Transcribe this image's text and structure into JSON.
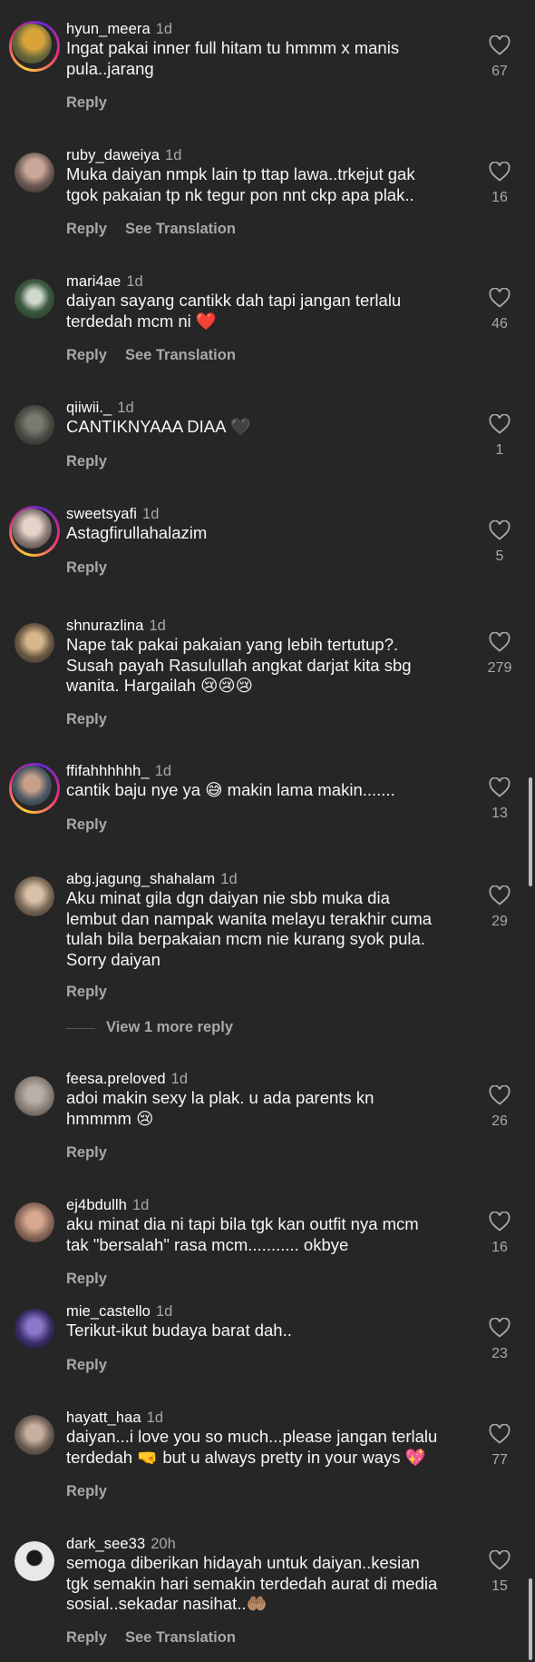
{
  "colors": {
    "background": "#262626",
    "text_primary": "#f5f5f5",
    "text_secondary": "#a8a8a8"
  },
  "comments": [
    {
      "username": "hyun_meera",
      "time": "1d",
      "text": "Ingat pakai inner full hitam tu hmmm x manis\npula..jarang",
      "likes": "67",
      "reply": "Reply",
      "translate": "",
      "story_ring": true,
      "avatar": "#6b6a3a"
    },
    {
      "username": "ruby_daweiya",
      "time": "1d",
      "text": "Muka daiyan nmpk lain tp ttap lawa..trkejut gak\ntgok pakaian tp nk tegur pon nnt ckp apa plak..",
      "likes": "16",
      "reply": "Reply",
      "translate": "See Translation",
      "story_ring": false,
      "avatar": "#6e5a55"
    },
    {
      "username": "mari4ae",
      "time": "1d",
      "text": "daiyan sayang cantikk dah tapi jangan terlalu\nterdedah mcm ni ❤️",
      "likes": "46",
      "reply": "Reply",
      "translate": "See Translation",
      "story_ring": false,
      "avatar": "#3d5a40"
    },
    {
      "username": "qiiwii._",
      "time": "1d",
      "text": "CANTIKNYAAA DIAA 🖤",
      "likes": "1",
      "reply": "Reply",
      "translate": "",
      "story_ring": false,
      "avatar": "#4a4a44"
    },
    {
      "username": "sweetsyafi",
      "time": "1d",
      "text": "Astagfirullahalazim",
      "likes": "5",
      "reply": "Reply",
      "translate": "",
      "story_ring": true,
      "avatar": "#8a7a78"
    },
    {
      "username": "shnurazlina",
      "time": "1d",
      "text": "Nape tak pakai pakaian yang lebih tertutup?.\nSusah payah Rasulullah angkat darjat kita sbg\nwanita. Hargailah 😢😢😢",
      "likes": "279",
      "reply": "Reply",
      "translate": "",
      "story_ring": false,
      "avatar": "#6b5a44"
    },
    {
      "username": "ffifahhhhhh_",
      "time": "1d",
      "text": "cantik baju nye ya 😅 makin lama makin.......",
      "likes": "13",
      "reply": "Reply",
      "translate": "",
      "story_ring": true,
      "avatar": "#4e5a66"
    },
    {
      "username": "abg.jagung_shahalam",
      "time": "1d",
      "text": "Aku minat gila dgn daiyan nie sbb muka dia\nlembut dan nampak wanita melayu terakhir cuma\ntulah bila berpakaian mcm nie kurang syok pula.\nSorry daiyan",
      "likes": "29",
      "reply": "Reply",
      "translate": "",
      "story_ring": false,
      "avatar": "#7a6a58"
    },
    {
      "username": "feesa.preloved",
      "time": "1d",
      "text": "adoi makin sexy la plak. u ada parents kn\nhmmmm 😢",
      "likes": "26",
      "reply": "Reply",
      "translate": "",
      "story_ring": false,
      "avatar": "#8a8078"
    },
    {
      "username": "ej4bdullh",
      "time": "1d",
      "text": "aku minat dia ni tapi bila tgk kan outfit nya mcm\ntak \"bersalah\" rasa mcm........... okbye",
      "likes": "16",
      "reply": "Reply",
      "translate": "",
      "story_ring": false,
      "avatar": "#8a6a5a"
    },
    {
      "username": "mie_castello",
      "time": "1d",
      "text": "Terikut-ikut budaya barat dah..",
      "likes": "23",
      "reply": "Reply",
      "translate": "",
      "story_ring": false,
      "avatar": "#3a2e6a"
    },
    {
      "username": "hayatt_haa",
      "time": "1d",
      "text": "daiyan...i love you so much...please jangan terlalu\nterdedah 🤜 but u always pretty in your ways 💖",
      "likes": "77",
      "reply": "Reply",
      "translate": "",
      "story_ring": false,
      "avatar": "#6e5e54"
    },
    {
      "username": "dark_see33",
      "time": "20h",
      "text": "semoga diberikan hidayah untuk daiyan..kesian\ntgk semakin hari semakin terdedah aurat di media\nsosial..sekadar nasihat..🤲🏽",
      "likes": "15",
      "reply": "Reply",
      "translate": "See Translation",
      "story_ring": false,
      "avatar": "#e8e8e8"
    }
  ],
  "more_replies": "View 1 more reply"
}
